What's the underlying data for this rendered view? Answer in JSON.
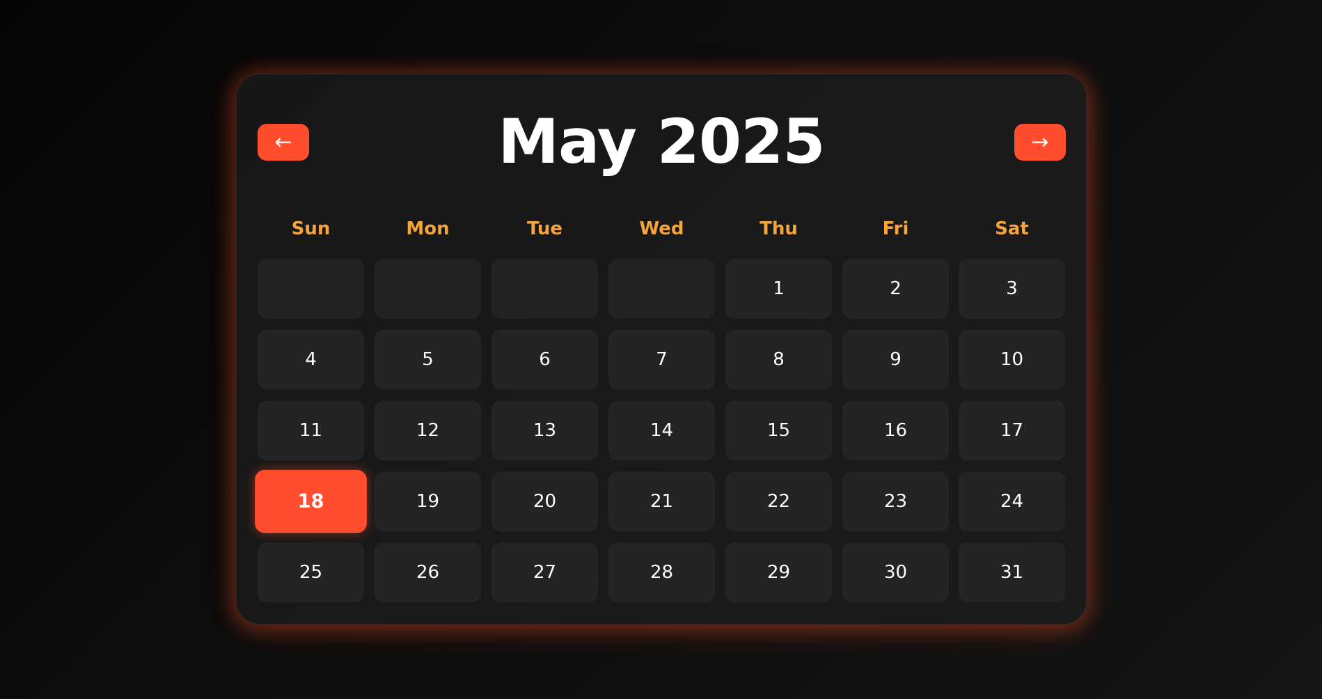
{
  "calendar": {
    "title": "May 2025",
    "prev_label": "←",
    "next_label": "→",
    "weekdays": [
      "Sun",
      "Mon",
      "Tue",
      "Wed",
      "Thu",
      "Fri",
      "Sat"
    ],
    "leading_blanks": 4,
    "days": [
      "1",
      "2",
      "3",
      "4",
      "5",
      "6",
      "7",
      "8",
      "9",
      "10",
      "11",
      "12",
      "13",
      "14",
      "15",
      "16",
      "17",
      "18",
      "19",
      "20",
      "21",
      "22",
      "23",
      "24",
      "25",
      "26",
      "27",
      "28",
      "29",
      "30",
      "31"
    ],
    "selected_day": "18"
  },
  "colors": {
    "accent": "#ff4d2e",
    "weekday_text": "#f5a33b",
    "cell_background": "#242424",
    "panel_background": "#1a1a1a",
    "text": "#ffffff"
  }
}
